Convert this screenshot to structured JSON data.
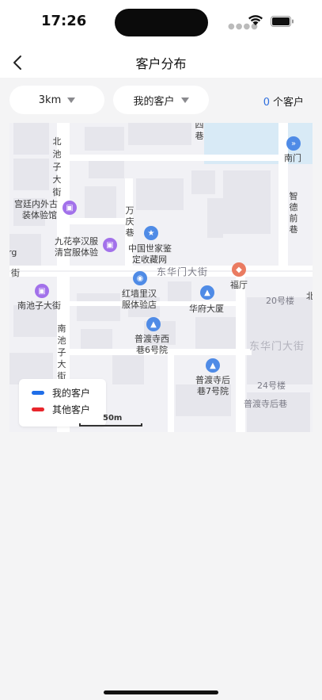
{
  "status_bar": {
    "time": "17:26"
  },
  "nav": {
    "title": "客户分布"
  },
  "filters": {
    "distance": "3km",
    "scope": "我的客户"
  },
  "customer_count": {
    "value": "0",
    "unit": "个客户"
  },
  "map": {
    "labels": {
      "north_chizi_1": "北",
      "north_chizi_2": "池",
      "north_chizi_3": "子",
      "north_chizi_4": "大",
      "north_chizi_5": "街",
      "top_si": "四",
      "top_xiang": "巷",
      "nanmen": "南门",
      "zhide_1": "智",
      "zhide_2": "德",
      "zhide_3": "前",
      "zhide_4": "巷",
      "gongting_1": "宫廷内外古",
      "gongting_2": "装体验馆",
      "wanqing_1": "万",
      "wanqing_2": "庆",
      "wanqing_3": "巷",
      "jiuhua_1": "九花亭汉服",
      "jiuhua_2": "清宫服体验",
      "zhongguo_1": "中国世家鉴",
      "zhongguo_2": "定收藏网",
      "rg": "rg",
      "jie_left": "街",
      "donghuamen_1": "东华门大街",
      "fuding": "福厅",
      "nanchizi": "南池子大街",
      "hongqiang_1": "红墙里汉",
      "hongqiang_2": "服体验店",
      "huafu": "华府大厦",
      "bldg20": "20号楼",
      "bei": "北",
      "nan_chizi_1": "南",
      "nan_chizi_2": "池",
      "nan_chizi_3": "子",
      "nan_chizi_4": "大",
      "nan_chizi_5": "街",
      "pudu_xi_1": "普渡寺西",
      "pudu_xi_2": "巷6号院",
      "donghuamen_2": "东华门大街",
      "pudu_hou_1": "普渡寺后",
      "pudu_hou_2": "巷7号院",
      "bldg24": "24号楼",
      "pudu_houxiang": "普渡寺后巷"
    },
    "scale": "50m",
    "legend": [
      {
        "label": "我的客户",
        "color": "#1f6ee8"
      },
      {
        "label": "其他客户",
        "color": "#e8262c"
      }
    ]
  }
}
